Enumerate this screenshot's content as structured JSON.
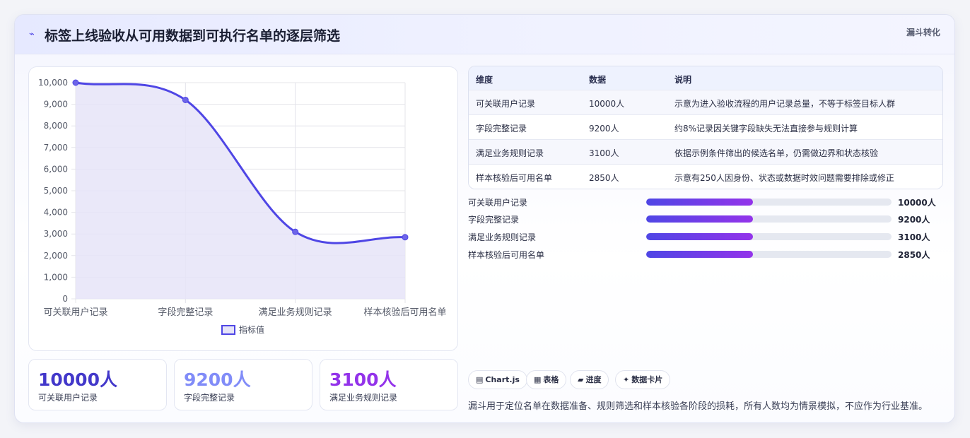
{
  "header": {
    "title": "标签上线验收从可用数据到可执行名单的逐层筛选",
    "tag": "漏斗转化",
    "icon": "trend-line-icon"
  },
  "chart_data": {
    "type": "line",
    "categories": [
      "可关联用户记录",
      "字段完整记录",
      "满足业务规则记录",
      "样本核验后可用名单"
    ],
    "series": [
      {
        "name": "指标值",
        "values": [
          10000,
          9200,
          3100,
          2850
        ]
      }
    ],
    "ylim": [
      0,
      10000
    ],
    "yticks": [
      "0",
      "1,000",
      "2,000",
      "3,000",
      "4,000",
      "5,000",
      "6,000",
      "7,000",
      "8,000",
      "9,000",
      "10,000"
    ],
    "grid": true,
    "legend": "bottom",
    "smooth": true,
    "fill": true,
    "colors": {
      "line": "#4f46e5",
      "fill": "#e6e4f8"
    }
  },
  "stats": [
    {
      "value": "10000人",
      "label": "可关联用户记录",
      "color": "#4338ca"
    },
    {
      "value": "9200人",
      "label": "字段完整记录",
      "color": "#818cf8"
    },
    {
      "value": "3100人",
      "label": "满足业务规则记录",
      "color": "#9333ea"
    }
  ],
  "table": {
    "headers": [
      "维度",
      "数据",
      "说明"
    ],
    "rows": [
      [
        "可关联用户记录",
        "10000人",
        "示意为进入验收流程的用户记录总量，不等于标签目标人群"
      ],
      [
        "字段完整记录",
        "9200人",
        "约8%记录因关键字段缺失无法直接参与规则计算"
      ],
      [
        "满足业务规则记录",
        "3100人",
        "依据示例条件筛出的候选名单，仍需做边界和状态核验"
      ],
      [
        "样本核验后可用名单",
        "2850人",
        "示意有250人因身份、状态或数据时效问题需要排除或修正"
      ]
    ]
  },
  "progress": [
    {
      "label": "可关联用户记录",
      "value": "10000人",
      "fraction": 0.435
    },
    {
      "label": "字段完整记录",
      "value": "9200人",
      "fraction": 0.435
    },
    {
      "label": "满足业务规则记录",
      "value": "3100人",
      "fraction": 0.435
    },
    {
      "label": "样本核验后可用名单",
      "value": "2850人",
      "fraction": 0.435
    }
  ],
  "chips": [
    {
      "icon": "▤",
      "label": "Chart.js"
    },
    {
      "icon": "▦",
      "label": "表格"
    },
    {
      "icon": "▰",
      "label": "进度"
    },
    {
      "icon": "✦",
      "label": "数据卡片"
    }
  ],
  "footnote": "漏斗用于定位名单在数据准备、规则筛选和样本核验各阶段的损耗，所有人数均为情景模拟，不应作为行业基准。"
}
